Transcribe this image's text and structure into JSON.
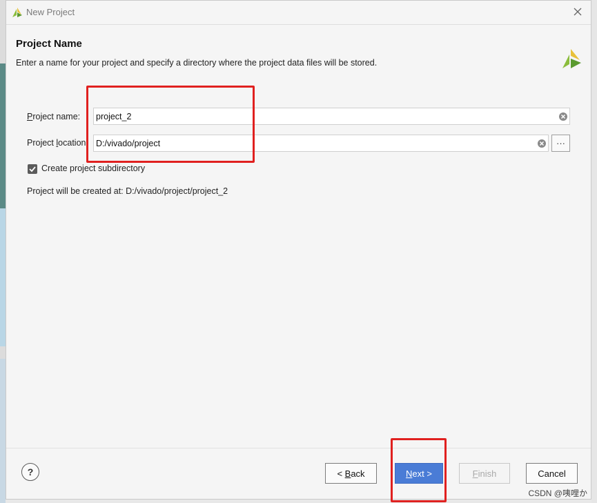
{
  "window": {
    "title": "New Project"
  },
  "header": {
    "title": "Project Name",
    "description": "Enter a name for your project and specify a directory where the project data files will be stored."
  },
  "form": {
    "project_name_label_prefix": "P",
    "project_name_label_rest": "roject name:",
    "project_name_value": "project_2",
    "project_location_label_prefix": "Project ",
    "project_location_label_underlined": "l",
    "project_location_label_rest": "ocation:",
    "project_location_value": "D:/vivado/project",
    "browse_label": "···",
    "subdirectory_checkbox_label": "Create project subdirectory",
    "subdirectory_checked": true,
    "created_at_text": "Project will be created at: D:/vivado/project/project_2"
  },
  "footer": {
    "help_label": "?",
    "back_prefix": "< ",
    "back_underlined": "B",
    "back_rest": "ack",
    "next_underlined": "N",
    "next_rest": "ext >",
    "finish_underlined": "F",
    "finish_rest": "inish",
    "cancel_label": "Cancel"
  },
  "colors": {
    "accent_primary_button": "#4a7cd6",
    "annotation_red": "#e0201f",
    "xilinx_logo_green": "#8bbd3c"
  },
  "icons": [
    "xilinx-logo-icon",
    "close-icon",
    "clear-icon",
    "checkmark-icon"
  ],
  "watermark": "CSDN @咦哩か"
}
